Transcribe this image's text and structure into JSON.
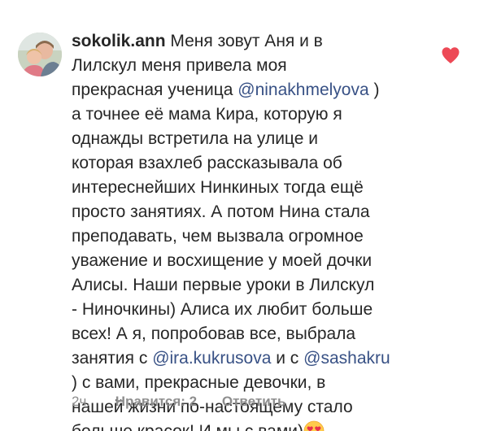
{
  "comment": {
    "username": "sokolik.ann",
    "lines": [
      "Меня зовут Аня и в",
      "Лилскул меня привела моя",
      "прекрасная ученица",
      ")",
      "а точнее её мама Кира, которую я",
      "однажды встретила на улице и",
      "которая взахлеб рассказывала об",
      "интереснейших Нинкиных тогда ещё",
      "просто занятиях. А потом Нина стала",
      "преподавать, чем вызвала огромное",
      "уважение и восхищение у моей дочки",
      "Алисы. Наши первые уроки в Лилскул",
      "- Ниночкины) Алиса их любит больше",
      "всех! А я, попробовав все, выбрала",
      "занятия с",
      "и с",
      ") с вами, прекрасные девочки, в",
      "нашей жизни по-настоящему стало",
      "больше красок! И мы с вами)"
    ],
    "mentions": {
      "nina": "@ninakhmelyova",
      "ira": "@ira.kukrusova",
      "sasha": "@sashakru"
    },
    "emoji_icon": "heart-eyes-emoji-icon",
    "like_icon": "heart-filled-icon",
    "like_color": "#ed4956",
    "mention_color": "#385185"
  },
  "meta": {
    "time": "2ч.",
    "likes": "Нравится: 2",
    "reply": "Ответить"
  }
}
